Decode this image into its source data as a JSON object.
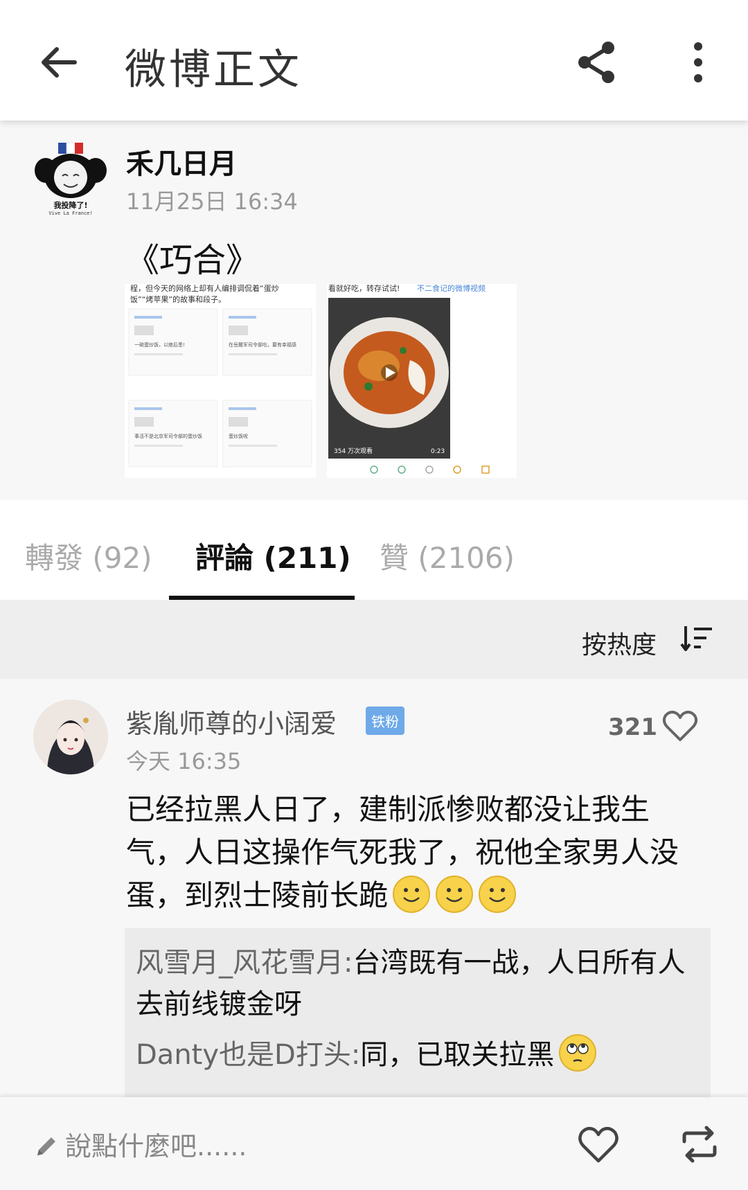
{
  "header": {
    "title": "微博正文",
    "back_icon": "arrow-left-icon",
    "share_icon": "share-icon",
    "more_icon": "more-vertical-icon"
  },
  "post": {
    "author": "禾几日月",
    "time": "11月25日 16:34",
    "text": "《巧合》",
    "avatar_caption": "我投降了!",
    "avatar_subcaption": "Vive La France!",
    "image1": {
      "text_line1": "程，但今天的网络上却有人编排调侃着“蛋炒",
      "text_line2": "饭”“烤苹果”的故事和段子。",
      "cards": [
        "一碗蛋炒饭，以绝后患!",
        "在岳麓军司令部吃，要有幸福感",
        "事活不是北京军司令部的蛋炒饭",
        "蛋炒饭呢"
      ]
    },
    "image2": {
      "caption": "看就好吃，转存试试!",
      "link": "不二食记的微博视频",
      "views": "354 万次观看",
      "duration": "0:23"
    }
  },
  "tabs": [
    {
      "label": "轉發 (92)",
      "active": false
    },
    {
      "label": "評論 (211)",
      "active": true
    },
    {
      "label": "贊 (2106)",
      "active": false
    }
  ],
  "sort": {
    "label": "按热度",
    "icon": "sort-icon"
  },
  "comment": {
    "user": "紫胤师尊的小阔爱",
    "badge": "铁粉",
    "time": "今天 16:35",
    "likes": "321",
    "text": "已经拉黑人日了，建制派惨败都没让我生气，人日这操作气死我了，祝他全家男人没蛋，到烈士陵前长跪",
    "replies": [
      {
        "user": "风雪月_风花雪月:",
        "text": "台湾既有一战，人日所有人去前线镀金呀"
      },
      {
        "user": "Danty也是D打头:",
        "text": "同，已取关拉黑"
      }
    ]
  },
  "bottom": {
    "placeholder": "說點什麼吧......",
    "like_icon": "heart-icon",
    "repost_icon": "repost-icon"
  },
  "colors": {
    "badge": "#6ea9e8",
    "active_tab": "#111111",
    "inactive_tab": "#aaaaaa"
  }
}
